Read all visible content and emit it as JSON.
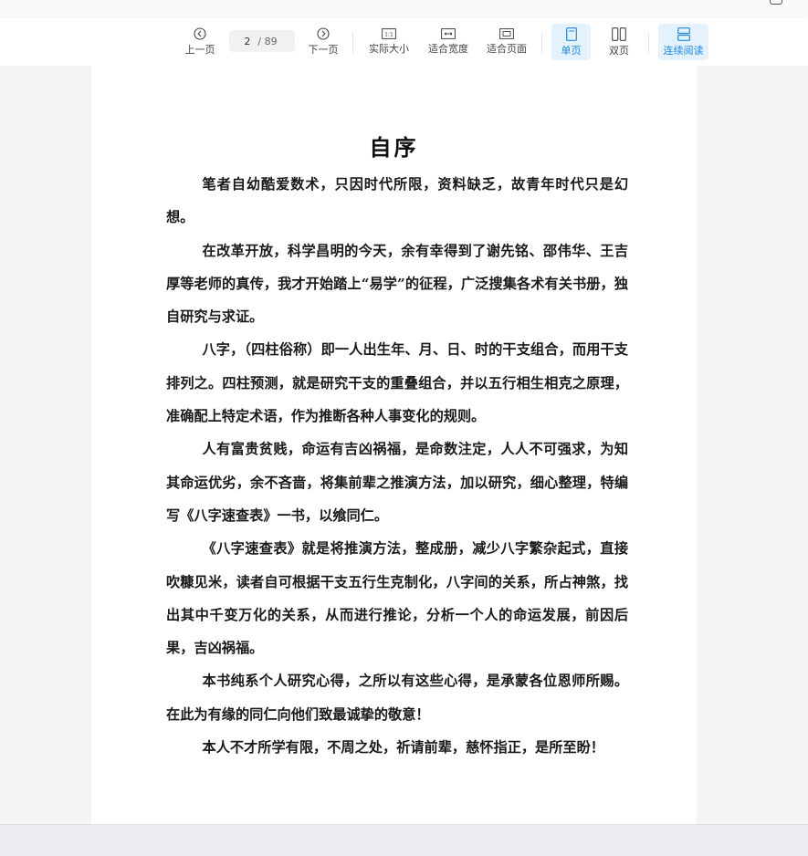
{
  "toolbar": {
    "prev_label": "上一页",
    "current_page": "2",
    "total_pages": "/ 89",
    "next_label": "下一页",
    "actual_size_label": "实际大小",
    "actual_size_icon_text": "1:1",
    "fit_width_label": "适合宽度",
    "fit_page_label": "适合页面",
    "single_page_label": "单页",
    "double_page_label": "双页",
    "continuous_label": "连续阅读",
    "accent_color": "#1e88e5"
  },
  "document": {
    "title": "自序",
    "paragraphs": [
      "笔者自幼酷爱数术，只因时代所限，资料缺乏，故青年时代只是幻想。",
      "在改革开放，科学昌明的今天，余有幸得到了谢先铭、邵伟华、王吉厚等老师的真传，我才开始踏上“易学”的征程，广泛搜集各术有关书册，独自研究与求证。",
      "八字，（四柱俗称）即一人出生年、月、日、时的干支组合，而用干支排列之。四柱预测，就是研究干支的重叠组合，并以五行相生相克之原理，准确配上特定术语，作为推断各种人事变化的规则。",
      "人有富贵贫贱，命运有吉凶祸福，是命数注定，人人不可强求，为知其命运优劣，余不吝啬，将集前辈之推演方法，加以研究，细心整理，特编写《八字速查表》一书，以飨同仁。",
      "《八字速查表》就是将推演方法，整成册，减少八字繁杂起式，直接吹糠见米，读者自可根据干支五行生克制化，八字间的关系，所占神煞，找出其中千变万化的关系，从而进行推论，分析一个人的命运发展，前因后果，吉凶祸福。",
      "本书纯系个人研究心得，之所以有这些心得，是承蒙各位恩师所赐。在此为有缘的同仁向他们致最诚挚的敬意！",
      "本人不才所学有限，不周之处，祈请前辈，慈怀指正，是所至盼！"
    ]
  }
}
